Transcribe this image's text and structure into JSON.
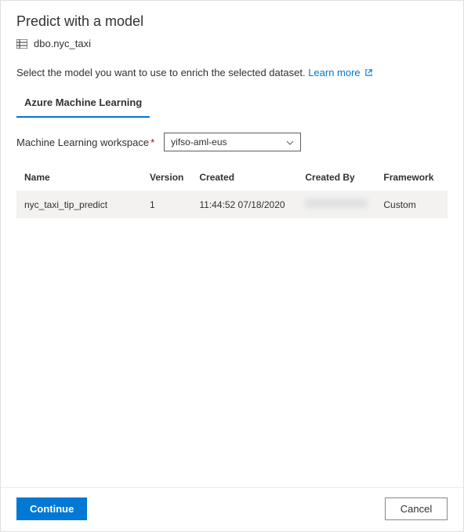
{
  "header": {
    "title": "Predict with a model",
    "dataset_name": "dbo.nyc_taxi"
  },
  "description": {
    "text": "Select the model you want to use to enrich the selected dataset.",
    "learn_more": "Learn more"
  },
  "tabs": {
    "aml": "Azure Machine Learning"
  },
  "workspace": {
    "label": "Machine Learning workspace",
    "selected": "yifso-aml-eus"
  },
  "table": {
    "headers": {
      "name": "Name",
      "version": "Version",
      "created": "Created",
      "created_by": "Created By",
      "framework": "Framework"
    },
    "rows": [
      {
        "name": "nyc_taxi_tip_predict",
        "version": "1",
        "created": "11:44:52 07/18/2020",
        "created_by": "",
        "framework": "Custom"
      }
    ]
  },
  "footer": {
    "continue": "Continue",
    "cancel": "Cancel"
  }
}
